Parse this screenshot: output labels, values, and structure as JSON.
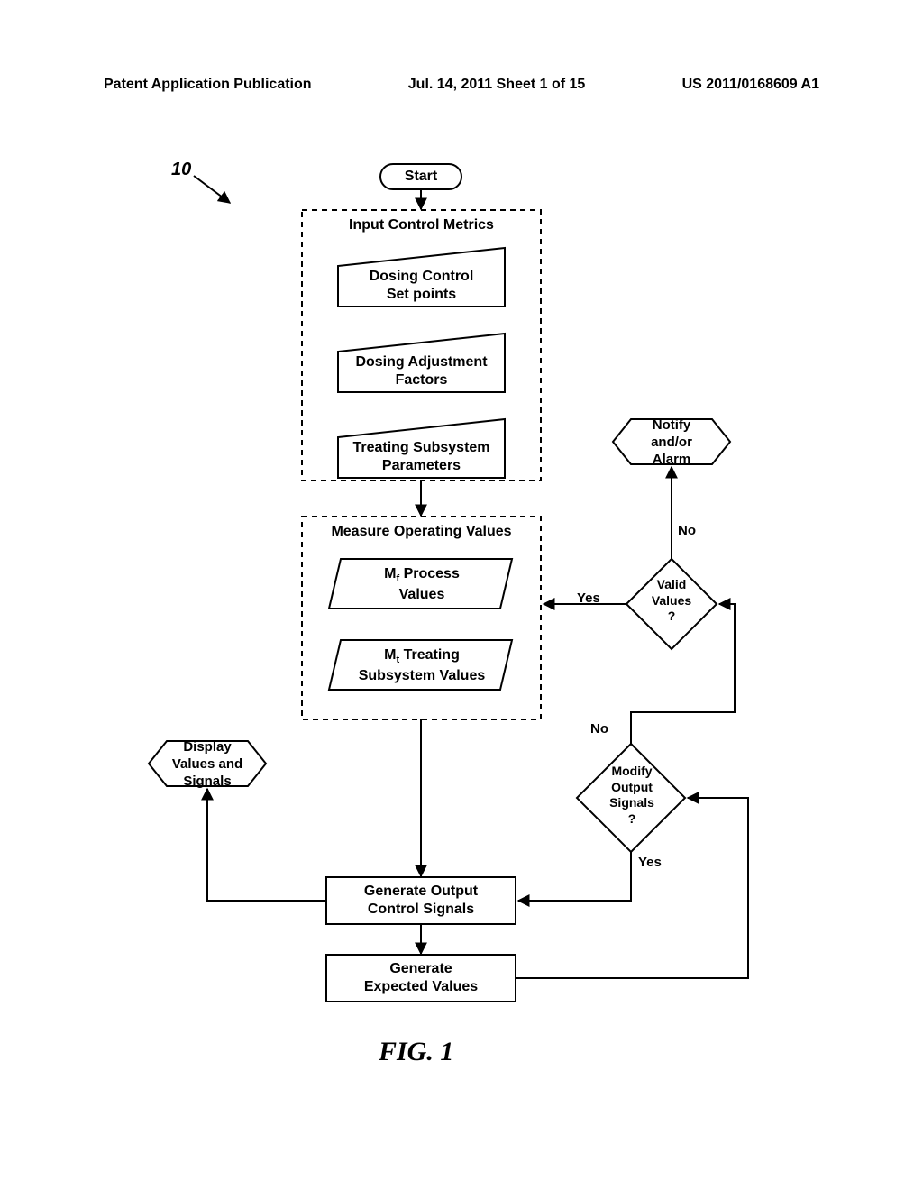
{
  "header": {
    "left": "Patent Application Publication",
    "center": "Jul. 14, 2011  Sheet 1 of 15",
    "right": "US 2011/0168609 A1"
  },
  "ref": {
    "num": "10"
  },
  "nodes": {
    "start": "Start",
    "group1_title": "Input Control Metrics",
    "setpoints": "Dosing Control\nSet points",
    "factors": "Dosing Adjustment\nFactors",
    "params": "Treating Subsystem\nParameters",
    "group2_title": "Measure Operating Values",
    "mf_pre": "M",
    "mf_sub": "f",
    "mf_post": "  Process\nValues",
    "mt_pre": "M",
    "mt_sub": "t",
    "mt_post": "  Treating\nSubsystem Values",
    "generate_out": "Generate Output\nControl Signals",
    "generate_exp": "Generate\nExpected Values",
    "display": "Display\nValues and\nSignals",
    "notify": "Notify\nand/or\nAlarm",
    "valid": "Valid\nValues\n?",
    "modify": "Modify\nOutput\nSignals\n?"
  },
  "edges": {
    "yes1": "Yes",
    "no1": "No",
    "yes2": "Yes",
    "no2": "No"
  },
  "figure": "FIG. 1"
}
